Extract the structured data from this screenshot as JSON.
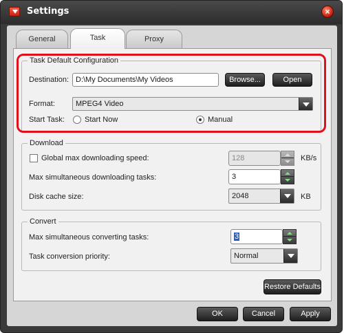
{
  "window": {
    "title": "Settings"
  },
  "tabs": [
    {
      "label": "General",
      "active": false
    },
    {
      "label": "Task",
      "active": true
    },
    {
      "label": "Proxy",
      "active": false
    }
  ],
  "task_default": {
    "legend": "Task Default Configuration",
    "destination_label": "Destination:",
    "destination_value": "D:\\My Documents\\My Videos",
    "browse_label": "Browse...",
    "open_label": "Open",
    "format_label": "Format:",
    "format_value": "MPEG4 Video",
    "start_task_label": "Start Task:",
    "start_now_label": "Start Now",
    "manual_label": "Manual",
    "start_task_selected": "Manual"
  },
  "download": {
    "legend": "Download",
    "global_speed_label": "Global max downloading speed:",
    "global_speed_checked": false,
    "global_speed_value": "128",
    "global_speed_unit": "KB/s",
    "max_tasks_label": "Max simultaneous downloading tasks:",
    "max_tasks_value": "3",
    "disk_cache_label": "Disk cache size:",
    "disk_cache_value": "2048",
    "disk_cache_unit": "KB"
  },
  "convert": {
    "legend": "Convert",
    "max_tasks_label": "Max simultaneous converting tasks:",
    "max_tasks_value": "3",
    "priority_label": "Task conversion priority:",
    "priority_value": "Normal"
  },
  "buttons": {
    "restore_defaults": "Restore Defaults",
    "ok": "OK",
    "cancel": "Cancel",
    "apply": "Apply"
  },
  "colors": {
    "highlight": "#e0101a",
    "spin_arrow": "#7ee07e"
  }
}
